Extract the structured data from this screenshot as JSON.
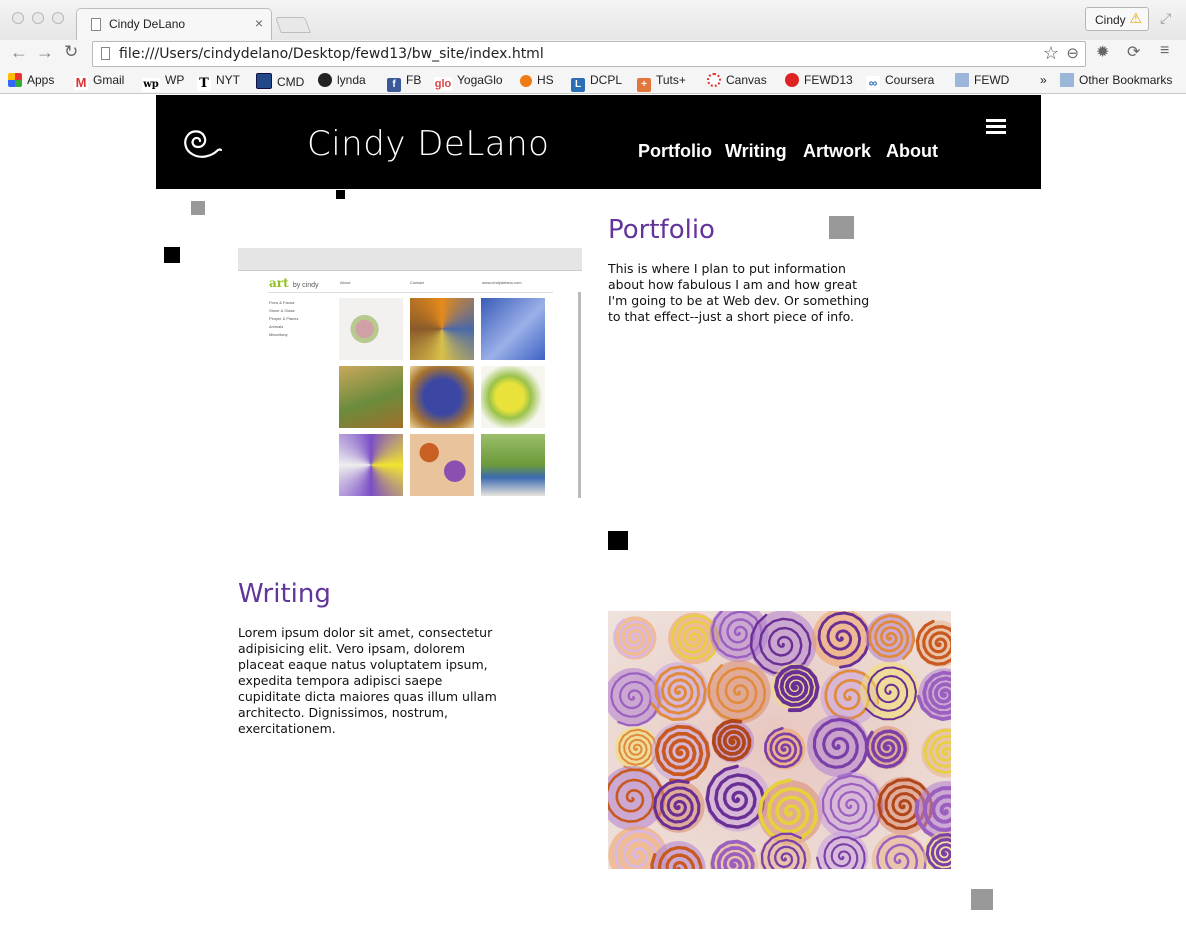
{
  "browser": {
    "tab_title": "Cindy DeLano",
    "tab_close": "×",
    "profile_label": "Cindy",
    "url": "file:///Users/cindydelano/Desktop/fewd13/bw_site/index.html",
    "bookmarks": [
      {
        "label": "Apps",
        "icon": "apps-grid-icon"
      },
      {
        "label": "Gmail",
        "icon": "gmail-icon"
      },
      {
        "label": "WP",
        "icon": "washington-post-icon"
      },
      {
        "label": "NYT",
        "icon": "nyt-icon"
      },
      {
        "label": "CMD",
        "icon": "cmd-icon"
      },
      {
        "label": "lynda",
        "icon": "lynda-icon"
      },
      {
        "label": "FB",
        "icon": "facebook-icon"
      },
      {
        "label": "YogaGlo",
        "icon": "glo-icon"
      },
      {
        "label": "HS",
        "icon": "hs-icon"
      },
      {
        "label": "DCPL",
        "icon": "dcpl-icon"
      },
      {
        "label": "Tuts+",
        "icon": "tuts-plus-icon"
      },
      {
        "label": "Canvas",
        "icon": "canvas-icon"
      },
      {
        "label": "FEWD13",
        "icon": "ga-icon"
      },
      {
        "label": "Coursera",
        "icon": "coursera-icon"
      },
      {
        "label": "FEWD",
        "icon": "folder-icon"
      }
    ],
    "bookmarks_overflow": "»",
    "other_bookmarks": "Other Bookmarks"
  },
  "site": {
    "title": "Cindy DeLano",
    "nav": [
      "Portfolio",
      "Writing",
      "Artwork",
      "About"
    ],
    "colors": {
      "header_bg": "#000000",
      "heading": "#63359a",
      "placeholder_gray": "#999999"
    }
  },
  "portfolio": {
    "heading": "Portfolio",
    "text": "This is where I plan to put information about how fabulous I am and how great I'm going to be at Web dev. Or something to that effect--just a short piece of info.",
    "preview": {
      "brand": "art",
      "brand_suffix": "by cindy",
      "nav": [
        "About",
        "Contact",
        "www.cindydelano.com"
      ],
      "side_links": [
        "Flora & Fauna",
        "Stone & Glass",
        "People & Places",
        "Animals",
        "Miscellany"
      ]
    }
  },
  "writing": {
    "heading": "Writing",
    "text": "Lorem ipsum dolor sit amet, consectetur adipisicing elit. Vero ipsam, dolorem placeat eaque natus voluptatem ipsum, expedita tempora adipisci saepe cupiditate dicta maiores quas illum ullam architecto. Dignissimos, nostrum, exercitationem."
  }
}
